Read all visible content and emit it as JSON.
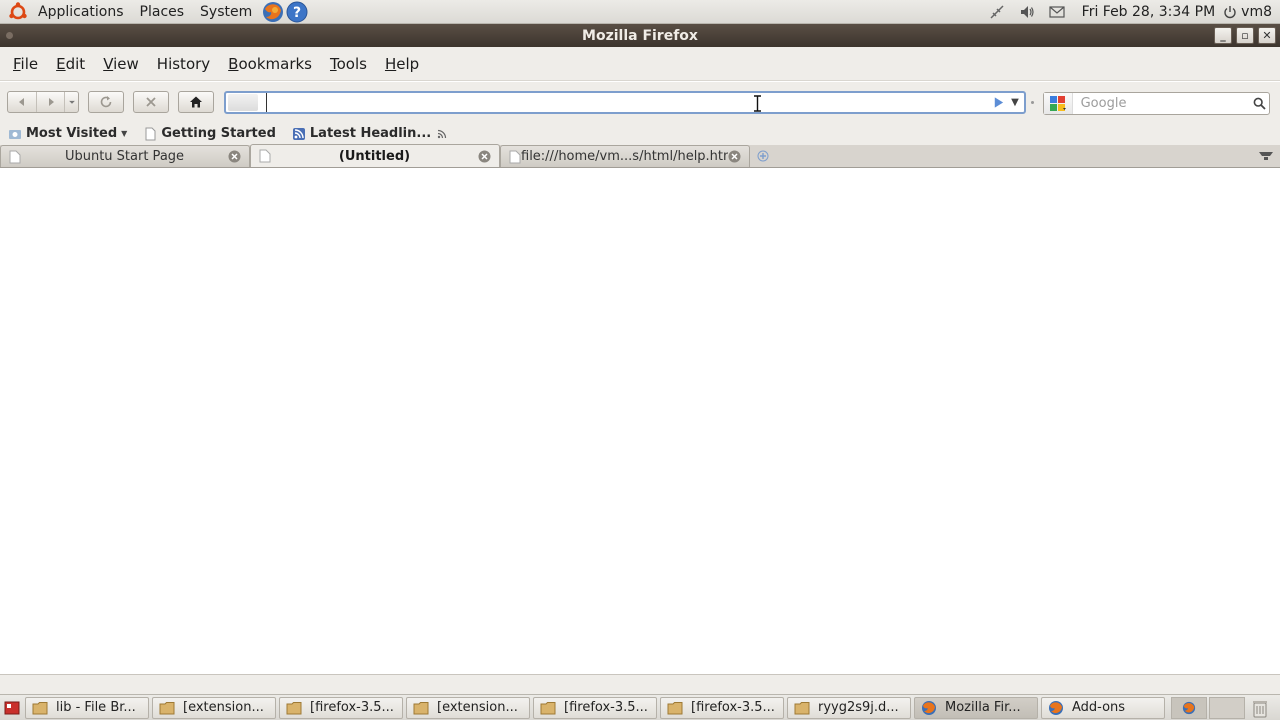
{
  "top_panel": {
    "menus": [
      "Applications",
      "Places",
      "System"
    ],
    "clock": "Fri Feb 28,  3:34 PM",
    "user": "vm8"
  },
  "window": {
    "title": "Mozilla Firefox"
  },
  "menubar": {
    "items": [
      {
        "first": "F",
        "rest": "ile"
      },
      {
        "first": "E",
        "rest": "dit"
      },
      {
        "first": "V",
        "rest": "iew"
      },
      {
        "first": "",
        "rest": "History",
        "under": "S"
      },
      {
        "first": "B",
        "rest": "ookmarks"
      },
      {
        "first": "T",
        "rest": "ools"
      },
      {
        "first": "H",
        "rest": "elp"
      }
    ]
  },
  "navbar": {
    "url_value": "",
    "search_placeholder": "Google"
  },
  "bookmarks": {
    "items": [
      "Most Visited",
      "Getting Started",
      "Latest Headlin..."
    ]
  },
  "tabs": [
    {
      "label": "Ubuntu Start Page",
      "active": false
    },
    {
      "label": "(Untitled)",
      "active": true
    },
    {
      "label": "file:///home/vm...s/html/help.htm",
      "active": false
    }
  ],
  "taskbar": {
    "tasks": [
      {
        "label": "lib - File Br...",
        "icon": "folder-icon"
      },
      {
        "label": "[extension...",
        "icon": "folder-icon"
      },
      {
        "label": "[firefox-3.5...",
        "icon": "folder-icon"
      },
      {
        "label": "[extension...",
        "icon": "folder-icon"
      },
      {
        "label": "[firefox-3.5...",
        "icon": "folder-icon"
      },
      {
        "label": "[firefox-3.5...",
        "icon": "folder-icon"
      },
      {
        "label": "ryyg2s9j.d...",
        "icon": "folder-icon"
      },
      {
        "label": "Mozilla Fir...",
        "icon": "firefox-icon",
        "active": true
      },
      {
        "label": "Add-ons",
        "icon": "firefox-icon"
      }
    ]
  },
  "colors": {
    "titlebar": "#4a4038",
    "url_focus": "#7d9ecd",
    "panel": "#e4e2dd"
  }
}
